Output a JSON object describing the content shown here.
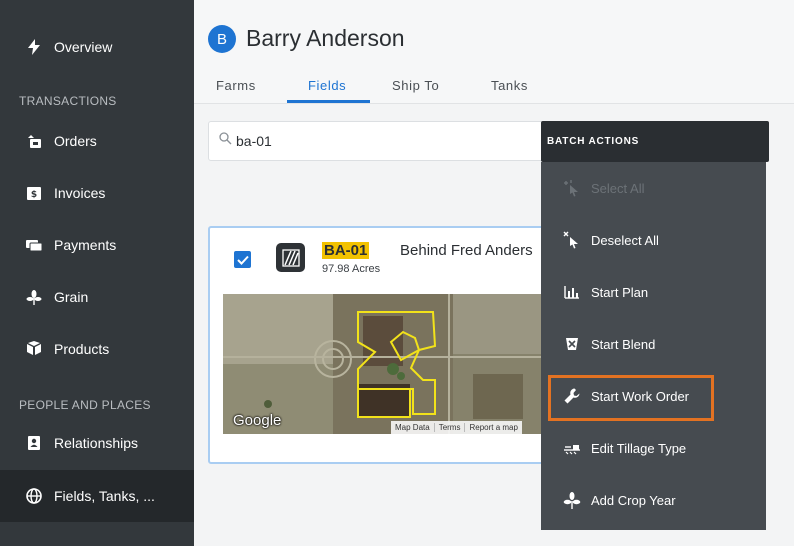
{
  "sidebar": {
    "items": [
      {
        "label": "Overview",
        "icon": "bolt-icon"
      },
      {
        "label": "Orders",
        "icon": "orders-icon"
      },
      {
        "label": "Invoices",
        "icon": "invoice-icon"
      },
      {
        "label": "Payments",
        "icon": "payments-icon"
      },
      {
        "label": "Grain",
        "icon": "grain-icon"
      },
      {
        "label": "Products",
        "icon": "products-icon"
      },
      {
        "label": "Relationships",
        "icon": "contacts-icon"
      },
      {
        "label": "Fields, Tanks, ...",
        "icon": "globe-icon",
        "active": true
      }
    ],
    "sections": {
      "transactions": "TRANSACTIONS",
      "people_places": "PEOPLE AND PLACES"
    }
  },
  "header": {
    "avatar_letter": "B",
    "name": "Barry Anderson",
    "tabs": [
      "Farms",
      "Fields",
      "Ship To",
      "Tanks"
    ],
    "active_tab": "Fields"
  },
  "search": {
    "value": "ba-01"
  },
  "field_card": {
    "checked": true,
    "name": "BA-01",
    "acres": "97.98 Acres",
    "description": "Behind Fred Anders",
    "map": {
      "logo": "Google",
      "attribution": [
        "Map Data",
        "Terms",
        "Report a map"
      ]
    }
  },
  "batch_menu": {
    "title": "BATCH ACTIONS",
    "items": [
      {
        "label": "Select All",
        "icon": "select-all-icon",
        "disabled": true
      },
      {
        "label": "Deselect All",
        "icon": "deselect-icon"
      },
      {
        "label": "Start Plan",
        "icon": "chart-icon"
      },
      {
        "label": "Start Blend",
        "icon": "blend-icon"
      },
      {
        "label": "Start Work Order",
        "icon": "wrench-icon",
        "highlighted": true
      },
      {
        "label": "Edit Tillage Type",
        "icon": "tillage-icon"
      },
      {
        "label": "Add Crop Year",
        "icon": "sprout-icon"
      }
    ]
  },
  "colors": {
    "sidebar": "#33383c",
    "accent": "#1e74d2",
    "highlight_box": "#e37222",
    "field_label_bg": "#f2c200",
    "menu_body": "#464b50"
  }
}
